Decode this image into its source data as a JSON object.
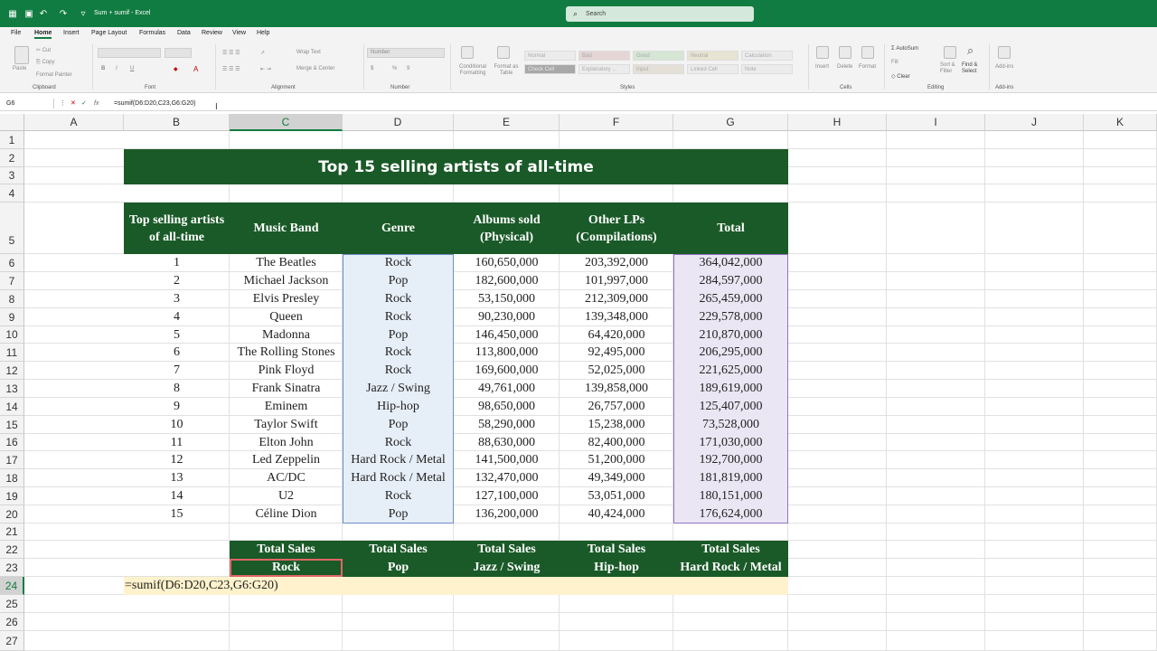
{
  "app": {
    "file_name": "Sum + sumif",
    "app_name": "Excel",
    "title_text": "Sum + sumif  -  Excel",
    "search_placeholder": "Search"
  },
  "menu": {
    "tabs": [
      "File",
      "Home",
      "Insert",
      "Page Layout",
      "Formulas",
      "Data",
      "Review",
      "View",
      "Help"
    ],
    "active": "Home"
  },
  "ribbon": {
    "clipboard": {
      "group": "Clipboard",
      "paste": "Paste",
      "cut": "Cut",
      "copy": "Copy",
      "format_painter": "Format Painter"
    },
    "font": {
      "group": "Font",
      "bold": "B",
      "italic": "I",
      "underline": "U"
    },
    "alignment": {
      "group": "Alignment",
      "wrap_text": "Wrap Text",
      "merge_center": "Merge & Center"
    },
    "number": {
      "group": "Number",
      "format": "Number",
      "percent": "%",
      "comma": "9"
    },
    "styles": {
      "group": "Styles",
      "conditional": "Conditional Formatting",
      "format_as_table": "Format as Table",
      "cells": [
        "Normal",
        "Bad",
        "Good",
        "Neutral",
        "Calculation",
        "Check Cell",
        "Explanatory ...",
        "Input",
        "Linked Cell",
        "Note"
      ]
    },
    "cells": {
      "group": "Cells",
      "insert": "Insert",
      "delete": "Delete",
      "format": "Format"
    },
    "editing": {
      "group": "Editing",
      "autosum": "AutoSum",
      "fill": "Fill",
      "clear": "Clear",
      "sort_filter": "Sort & Filter",
      "find_select": "Find & Select"
    },
    "addins": {
      "group": "Add-ins",
      "label": "Add-ins"
    }
  },
  "formula_bar": {
    "name_box": "G6",
    "fx": "fx",
    "formula": "=sumif(D6:D20,C23,G6:G20)"
  },
  "grid": {
    "columns": [
      "A",
      "B",
      "C",
      "D",
      "E",
      "F",
      "G",
      "H",
      "I",
      "J",
      "K"
    ],
    "rows": [
      "1",
      "2",
      "3",
      "4",
      "5",
      "6",
      "7",
      "8",
      "9",
      "10",
      "11",
      "12",
      "13",
      "14",
      "15",
      "16",
      "17",
      "18",
      "19",
      "20",
      "21",
      "22",
      "23",
      "24",
      "25",
      "26",
      "27"
    ]
  },
  "sheet": {
    "title": "Top 15 selling artists of all-time",
    "headers": {
      "rank": "Top selling artists of all-time",
      "band": "Music Band",
      "genre": "Genre",
      "albums": "Albums sold (Physical)",
      "other": "Other LPs (Compilations)",
      "total": "Total"
    },
    "rows": [
      {
        "rank": "1",
        "band": "The Beatles",
        "genre": "Rock",
        "albums": "160,650,000",
        "other": "203,392,000",
        "total": "364,042,000"
      },
      {
        "rank": "2",
        "band": "Michael Jackson",
        "genre": "Pop",
        "albums": "182,600,000",
        "other": "101,997,000",
        "total": "284,597,000"
      },
      {
        "rank": "3",
        "band": "Elvis Presley",
        "genre": "Rock",
        "albums": "53,150,000",
        "other": "212,309,000",
        "total": "265,459,000"
      },
      {
        "rank": "4",
        "band": "Queen",
        "genre": "Rock",
        "albums": "90,230,000",
        "other": "139,348,000",
        "total": "229,578,000"
      },
      {
        "rank": "5",
        "band": "Madonna",
        "genre": "Pop",
        "albums": "146,450,000",
        "other": "64,420,000",
        "total": "210,870,000"
      },
      {
        "rank": "6",
        "band": "The Rolling Stones",
        "genre": "Rock",
        "albums": "113,800,000",
        "other": "92,495,000",
        "total": "206,295,000"
      },
      {
        "rank": "7",
        "band": "Pink Floyd",
        "genre": "Rock",
        "albums": "169,600,000",
        "other": "52,025,000",
        "total": "221,625,000"
      },
      {
        "rank": "8",
        "band": "Frank Sinatra",
        "genre": "Jazz / Swing",
        "albums": "49,761,000",
        "other": "139,858,000",
        "total": "189,619,000"
      },
      {
        "rank": "9",
        "band": "Eminem",
        "genre": "Hip-hop",
        "albums": "98,650,000",
        "other": "26,757,000",
        "total": "125,407,000"
      },
      {
        "rank": "10",
        "band": "Taylor Swift",
        "genre": "Pop",
        "albums": "58,290,000",
        "other": "15,238,000",
        "total": "73,528,000"
      },
      {
        "rank": "11",
        "band": "Elton John",
        "genre": "Rock",
        "albums": "88,630,000",
        "other": "82,400,000",
        "total": "171,030,000"
      },
      {
        "rank": "12",
        "band": "Led Zeppelin",
        "genre": "Hard Rock / Metal",
        "albums": "141,500,000",
        "other": "51,200,000",
        "total": "192,700,000"
      },
      {
        "rank": "13",
        "band": "AC/DC",
        "genre": "Hard Rock / Metal",
        "albums": "132,470,000",
        "other": "49,349,000",
        "total": "181,819,000"
      },
      {
        "rank": "14",
        "band": "U2",
        "genre": "Rock",
        "albums": "127,100,000",
        "other": "53,051,000",
        "total": "180,151,000"
      },
      {
        "rank": "15",
        "band": "Céline Dion",
        "genre": "Pop",
        "albums": "136,200,000",
        "other": "40,424,000",
        "total": "176,624,000"
      }
    ],
    "summary": [
      {
        "label": "Total Sales",
        "genre": "Rock"
      },
      {
        "label": "Total Sales",
        "genre": "Pop"
      },
      {
        "label": "Total Sales",
        "genre": "Jazz / Swing"
      },
      {
        "label": "Total Sales",
        "genre": "Hip-hop"
      },
      {
        "label": "Total Sales",
        "genre": "Hard Rock / Metal"
      }
    ],
    "editing_cell_text": "=sumif(D6:D20,C23,G6:G20)"
  },
  "colors": {
    "excel_green": "#107c41",
    "header_green": "#1a5a28",
    "genre_highlight": "#e6eef7",
    "total_highlight": "#ebe6f4",
    "edit_row": "#fff2cc",
    "selection_red": "#e06666"
  }
}
